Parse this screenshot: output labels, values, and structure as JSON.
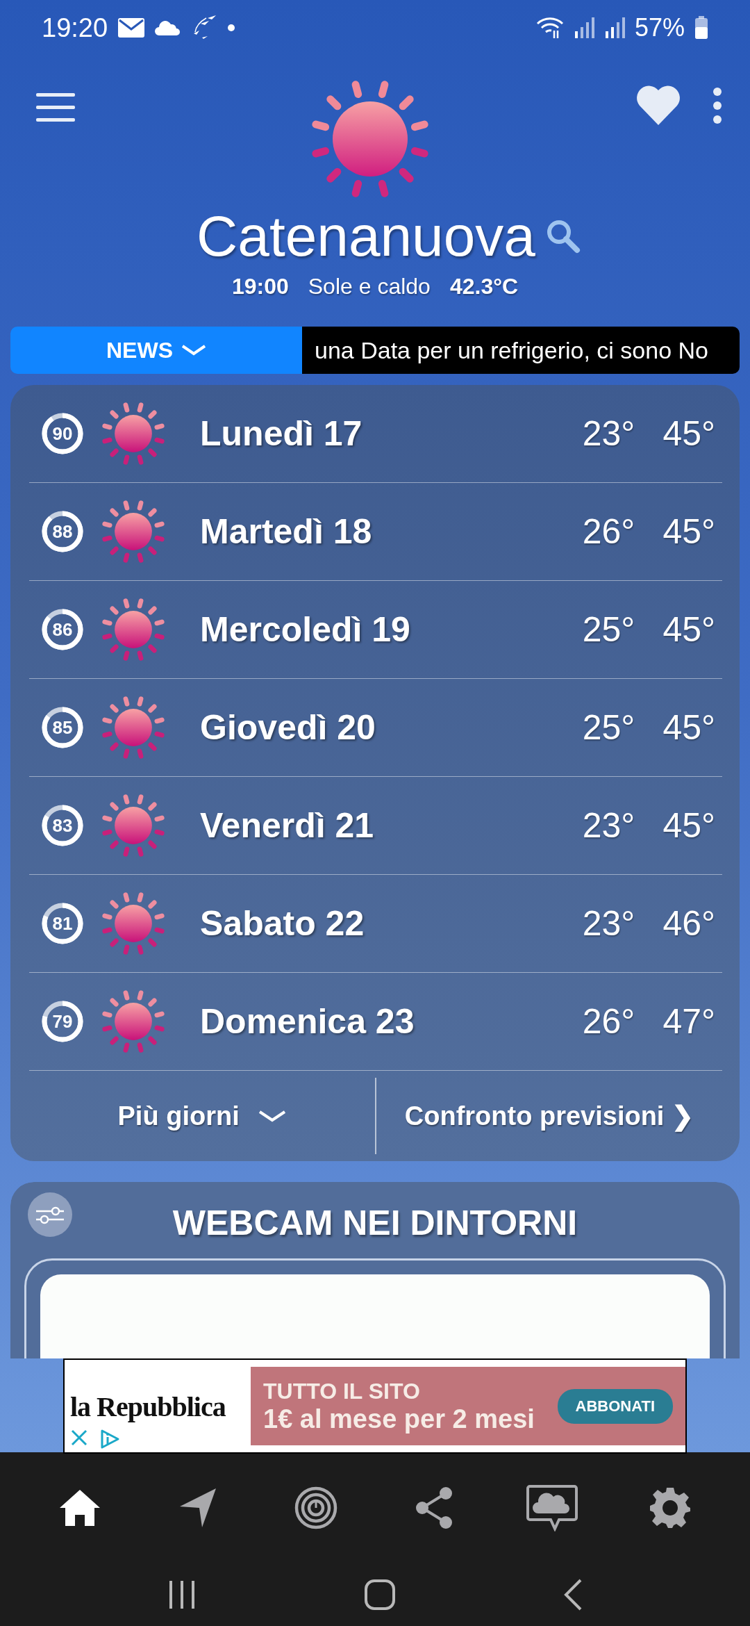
{
  "status_bar": {
    "time": "19:20",
    "battery": "57%"
  },
  "header": {
    "city": "Catenanuova",
    "time": "19:00",
    "condition": "Sole e caldo",
    "temperature": "42.3°C",
    "kind": "sunny"
  },
  "news": {
    "label": "NEWS",
    "ticker": "una Data per un refrigerio, ci sono No"
  },
  "forecast": [
    {
      "day": "Lunedì 17",
      "reliability": "90",
      "level": 0.9,
      "kind": "sunny",
      "min": "23°",
      "max": "45°"
    },
    {
      "day": "Martedì 18",
      "reliability": "88",
      "level": 0.88,
      "kind": "sunny",
      "min": "26°",
      "max": "45°"
    },
    {
      "day": "Mercoledì 19",
      "reliability": "86",
      "level": 0.86,
      "kind": "sunny",
      "min": "25°",
      "max": "45°"
    },
    {
      "day": "Giovedì 20",
      "reliability": "85",
      "level": 0.85,
      "kind": "sunny",
      "min": "25°",
      "max": "45°"
    },
    {
      "day": "Venerdì 21",
      "reliability": "83",
      "level": 0.83,
      "kind": "sunny",
      "min": "23°",
      "max": "45°"
    },
    {
      "day": "Sabato 22",
      "reliability": "81",
      "level": 0.81,
      "kind": "sunny",
      "min": "23°",
      "max": "46°"
    },
    {
      "day": "Domenica 23",
      "reliability": "79",
      "level": 0.79,
      "kind": "sunny",
      "min": "26°",
      "max": "47°"
    }
  ],
  "forecast_footer": {
    "more_days": "Più giorni",
    "compare": "Confronto previsioni",
    "compare_icon": "❯"
  },
  "webcam": {
    "title": "WEBCAM NEI DINTORNI"
  },
  "ad": {
    "brand": "la Repubblica",
    "headline": "TUTTO IL SITO",
    "offer": "1€ al mese per 2 mesi",
    "button": "ABBONATI"
  },
  "bottom_nav": [
    {
      "kind": "home",
      "selected": true
    },
    {
      "kind": "location",
      "selected": false
    },
    {
      "kind": "radar",
      "selected": false
    },
    {
      "kind": "share",
      "selected": false
    },
    {
      "kind": "chat",
      "selected": false
    },
    {
      "kind": "settings",
      "selected": false
    }
  ]
}
